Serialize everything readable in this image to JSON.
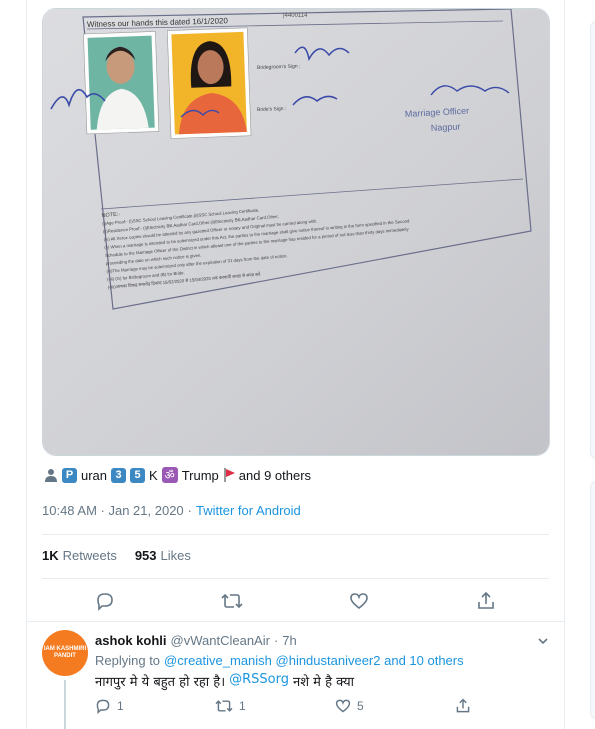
{
  "tweet": {
    "tagged": {
      "name_badge": "P",
      "name_rest": "uran",
      "num1": "3",
      "num2": "5",
      "k": "K",
      "om": "ॐ",
      "trump": "Trump",
      "others": "and 9 others"
    },
    "time": "10:48 AM · Jan 21, 2020",
    "source": "Twitter for Android",
    "retweets_count": "1K",
    "retweets_label": "Retweets",
    "likes_count": "953",
    "likes_label": "Likes"
  },
  "document": {
    "header": "Witness our hands this dated 16/1/2020",
    "sign1_label": "Bridegroom's Sign :",
    "sign2_label": "Bride's Sign :",
    "officer": "Marriage Officer",
    "place": "Nagpur",
    "note_title": "NOTE:-",
    "note_lines": [
      "(i)Age Proof:- (i)SSC School Leaving Certificate,(ii)SSC School Leaving Certificate,",
      "(ii)Residence Proof:- (i)Electricity Bill,Aadhar Card,Other,(ii)Electricity Bill,Aadhar Card,Other,",
      "(iv) All Xerox copies should be attested by any gazetted Officer or notary and Original must be carried along with.",
      "(v) When a marriage is intended to be solemnized under this Act, the parties to the marriage shall give notice thereof in writing in the form specified in the Second",
      "Schedule to the Marriage Officer of the District in which atleast one of the parties to the marriage has resided for a period of not less than thirty days immediately",
      "proceeding the date on which such notice is given.",
      "(vi)The Marriage may be solemnized only after the expiration of 31 days from the date of notice.",
      "(vii) (G) for Bridegroom and (B) for Bride.",
      "(viii)आपका विवाह समारोह दिनांक 15/02/2020 से 15/04/2020 तक करवायी शाखा से संपन्न करें."
    ]
  },
  "reply": {
    "avatar_text": "IAM KASHMIRI PANDIT",
    "name": "ashok kohli",
    "handle": "@vWantCleanAir",
    "dot": "·",
    "time": "7h",
    "replying_label": "Replying to",
    "replying_to": "@creative_manish @hindustaniveer2 and 10 others",
    "text_start": "नागपुर मे ये बहुत हो रहा है।",
    "mention": "@RSSorg",
    "text_end": "नशे मे है क्या",
    "reply_count": "1",
    "retweet_count": "1",
    "like_count": "5"
  },
  "colors": {
    "link": "#1b95e0",
    "muted": "#657786",
    "text": "#14171a",
    "border": "#e6ecf0",
    "avatar": "#f47b20"
  }
}
